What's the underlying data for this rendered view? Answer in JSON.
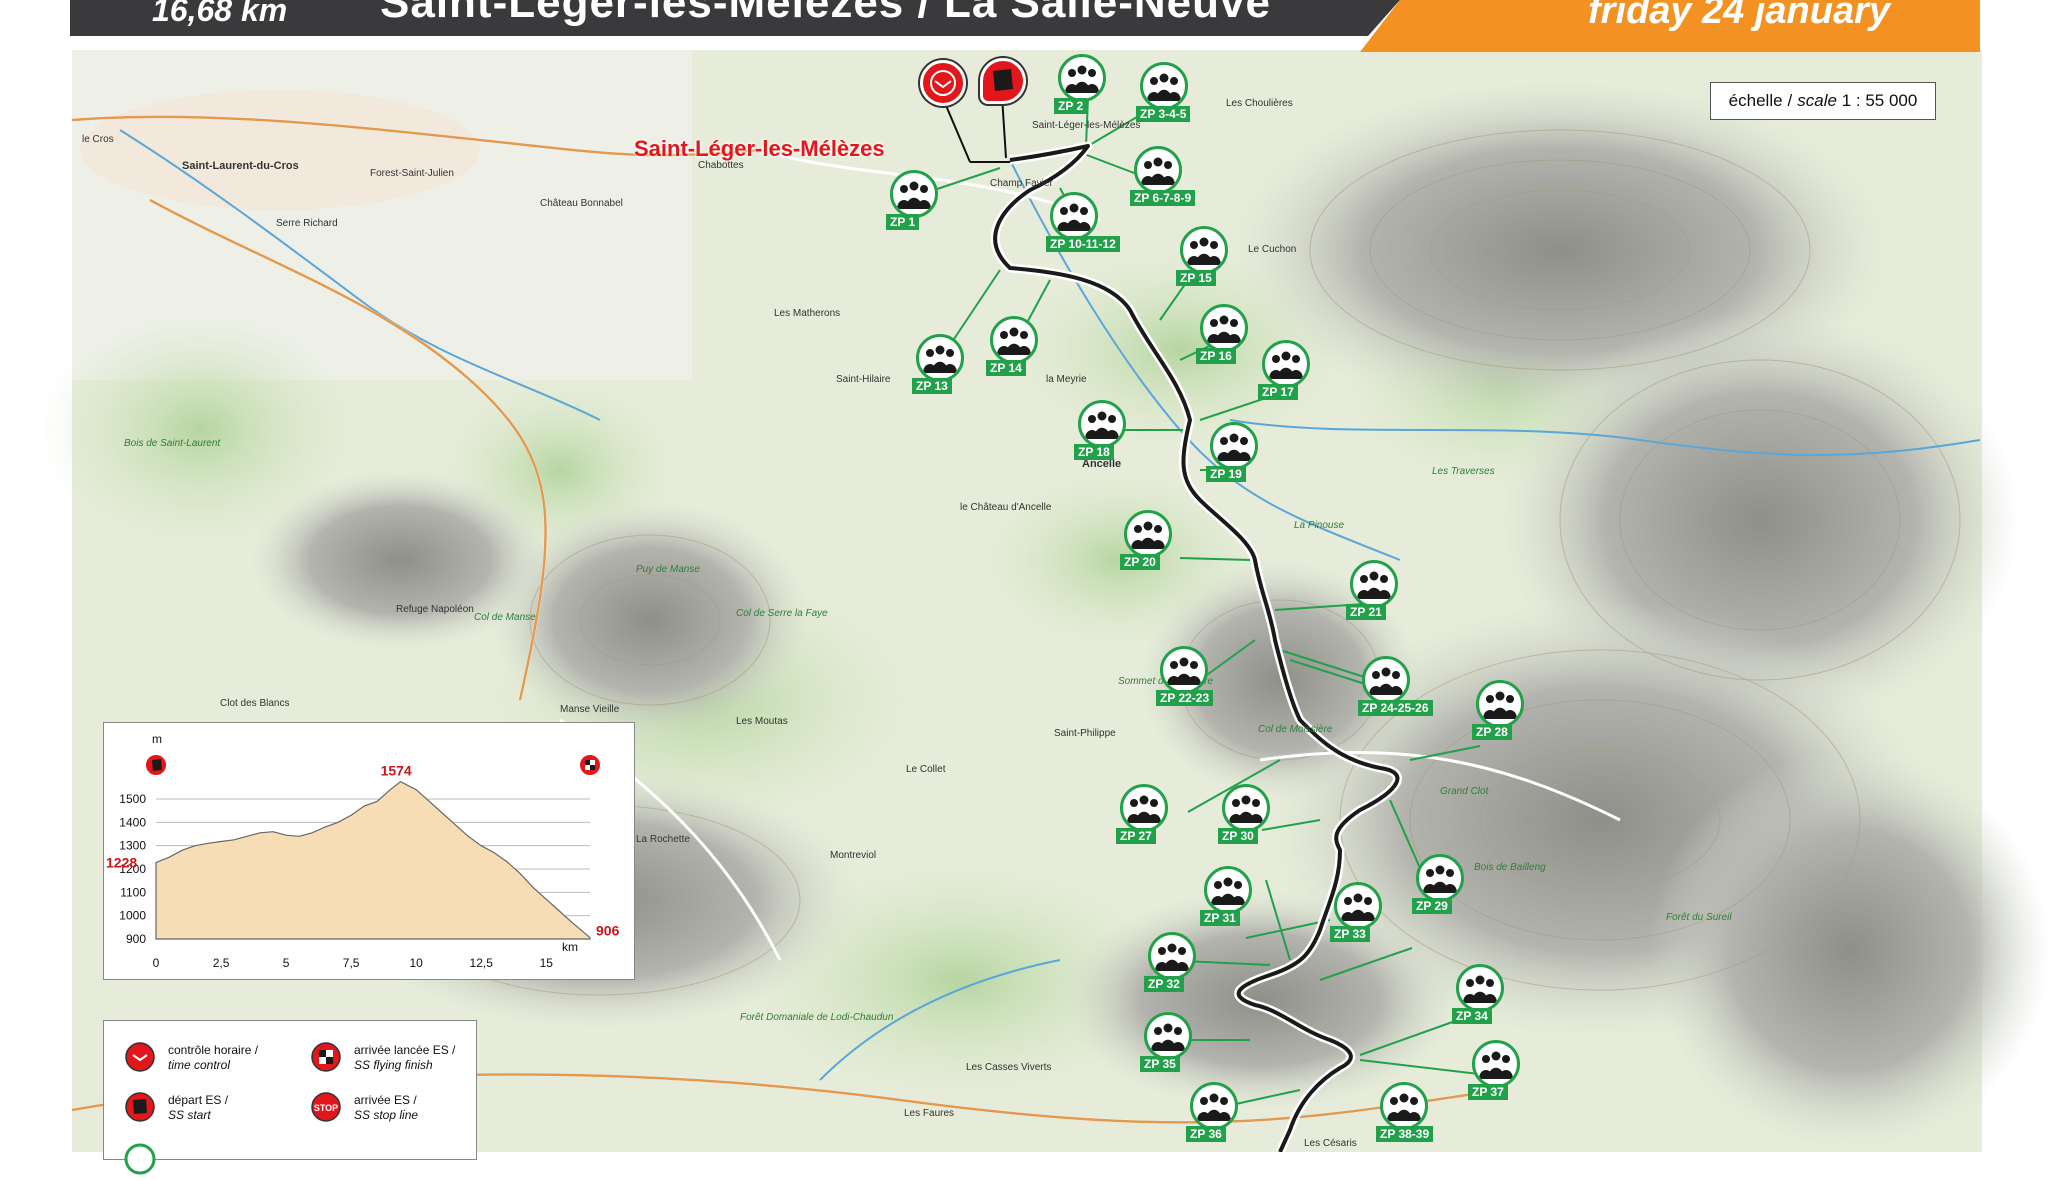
{
  "header": {
    "distance": "16,68 km",
    "stage_title": "Saint-Léger-les-Mélèzes / La Salle-Neuve",
    "date": "friday 24 january"
  },
  "scale": {
    "label_fr": "échelle",
    "label_en": "scale",
    "ratio": "1 : 55 000"
  },
  "town_label": "Saint-Léger-les-Mélèzes",
  "colors": {
    "header_dark": "#3a3a3c",
    "header_orange": "#f39223",
    "route": "#1a1a1a",
    "zone_green": "#22a04a",
    "marker_red": "#e2161b"
  },
  "markers": [
    {
      "name": "time-control-marker",
      "icon": "clock-icon"
    },
    {
      "name": "ss-start-marker",
      "icon": "flag-icon"
    }
  ],
  "zones": [
    "ZP 1",
    "ZP 2",
    "ZP 3-4-5",
    "ZP 6-7-8-9",
    "ZP 10-11-12",
    "ZP 13",
    "ZP 14",
    "ZP 15",
    "ZP 16",
    "ZP 17",
    "ZP 18",
    "ZP 19",
    "ZP 20",
    "ZP 21",
    "ZP 22-23",
    "ZP 24-25-26",
    "ZP 27",
    "ZP 28",
    "ZP 29",
    "ZP 30",
    "ZP 31",
    "ZP 32",
    "ZP 33",
    "ZP 34",
    "ZP 35",
    "ZP 36",
    "ZP 37",
    "ZP 38-39"
  ],
  "map_labels": [
    "Saint-Laurent-du-Cros",
    "Forest-Saint-Julien",
    "Château Bonnabel",
    "Saint-Léger-les-Mélèzes",
    "Chabottes",
    "Champ Favier",
    "Les Matherons",
    "Saint-Hilaire",
    "le Château d'Ancelle",
    "Ancelle",
    "La Pinouse",
    "Les Traverses",
    "Bois de Saint-Laurent",
    "Refuge Napoléon",
    "Col de Manse",
    "Col de Serre la Faye",
    "Puy de Manse",
    "Col de Moissière",
    "Grand Clot",
    "Bois de Bailleng",
    "Forêt du Sureil",
    "Serre Richard",
    "le Cros",
    "La Rochette",
    "Montreviol",
    "Les Moutas",
    "Manse Vieille",
    "Clot des Blancs",
    "Le Cuchon",
    "Les Choulières",
    "la Meyrie",
    "Sommet de Chatégre",
    "Forêt Domaniale de Lodi-Chaudun",
    "Le Collet",
    "Saint-Philippe",
    "Les Césaris",
    "Les Faures",
    "Les Casses Viverts"
  ],
  "profile": {
    "unit_y": "m",
    "unit_x": "km",
    "y_ticks": [
      "1500",
      "1400",
      "1300",
      "1200",
      "1100",
      "1000",
      "900"
    ],
    "x_ticks": [
      "0",
      "2,5",
      "5",
      "7,5",
      "10",
      "12,5",
      "15"
    ],
    "start_label": "1228",
    "peak_label": "1574",
    "end_label": "906",
    "start_alt": 1228,
    "peak_alt": 1574,
    "end_alt": 906,
    "points": [
      [
        0,
        1228
      ],
      [
        0.5,
        1250
      ],
      [
        1,
        1280
      ],
      [
        1.5,
        1300
      ],
      [
        2,
        1310
      ],
      [
        2.5,
        1318
      ],
      [
        3,
        1325
      ],
      [
        3.5,
        1340
      ],
      [
        4,
        1355
      ],
      [
        4.5,
        1360
      ],
      [
        5,
        1345
      ],
      [
        5.5,
        1340
      ],
      [
        6,
        1355
      ],
      [
        6.5,
        1380
      ],
      [
        7,
        1400
      ],
      [
        7.5,
        1430
      ],
      [
        8,
        1470
      ],
      [
        8.5,
        1490
      ],
      [
        9,
        1540
      ],
      [
        9.4,
        1574
      ],
      [
        10,
        1540
      ],
      [
        10.5,
        1490
      ],
      [
        11,
        1440
      ],
      [
        11.5,
        1390
      ],
      [
        12,
        1340
      ],
      [
        12.5,
        1300
      ],
      [
        13,
        1270
      ],
      [
        13.5,
        1230
      ],
      [
        14,
        1180
      ],
      [
        14.5,
        1120
      ],
      [
        15,
        1070
      ],
      [
        15.5,
        1020
      ],
      [
        16,
        970
      ],
      [
        16.68,
        906
      ]
    ]
  },
  "legend": [
    {
      "fr": "contrôle horaire /",
      "en": "time control"
    },
    {
      "fr": "arrivée lancée ES /",
      "en": "SS flying finish"
    },
    {
      "fr": "départ ES /",
      "en": "SS start"
    },
    {
      "fr": "arrivée ES /",
      "en": "SS stop line"
    },
    {
      "stop": "STOP"
    }
  ]
}
